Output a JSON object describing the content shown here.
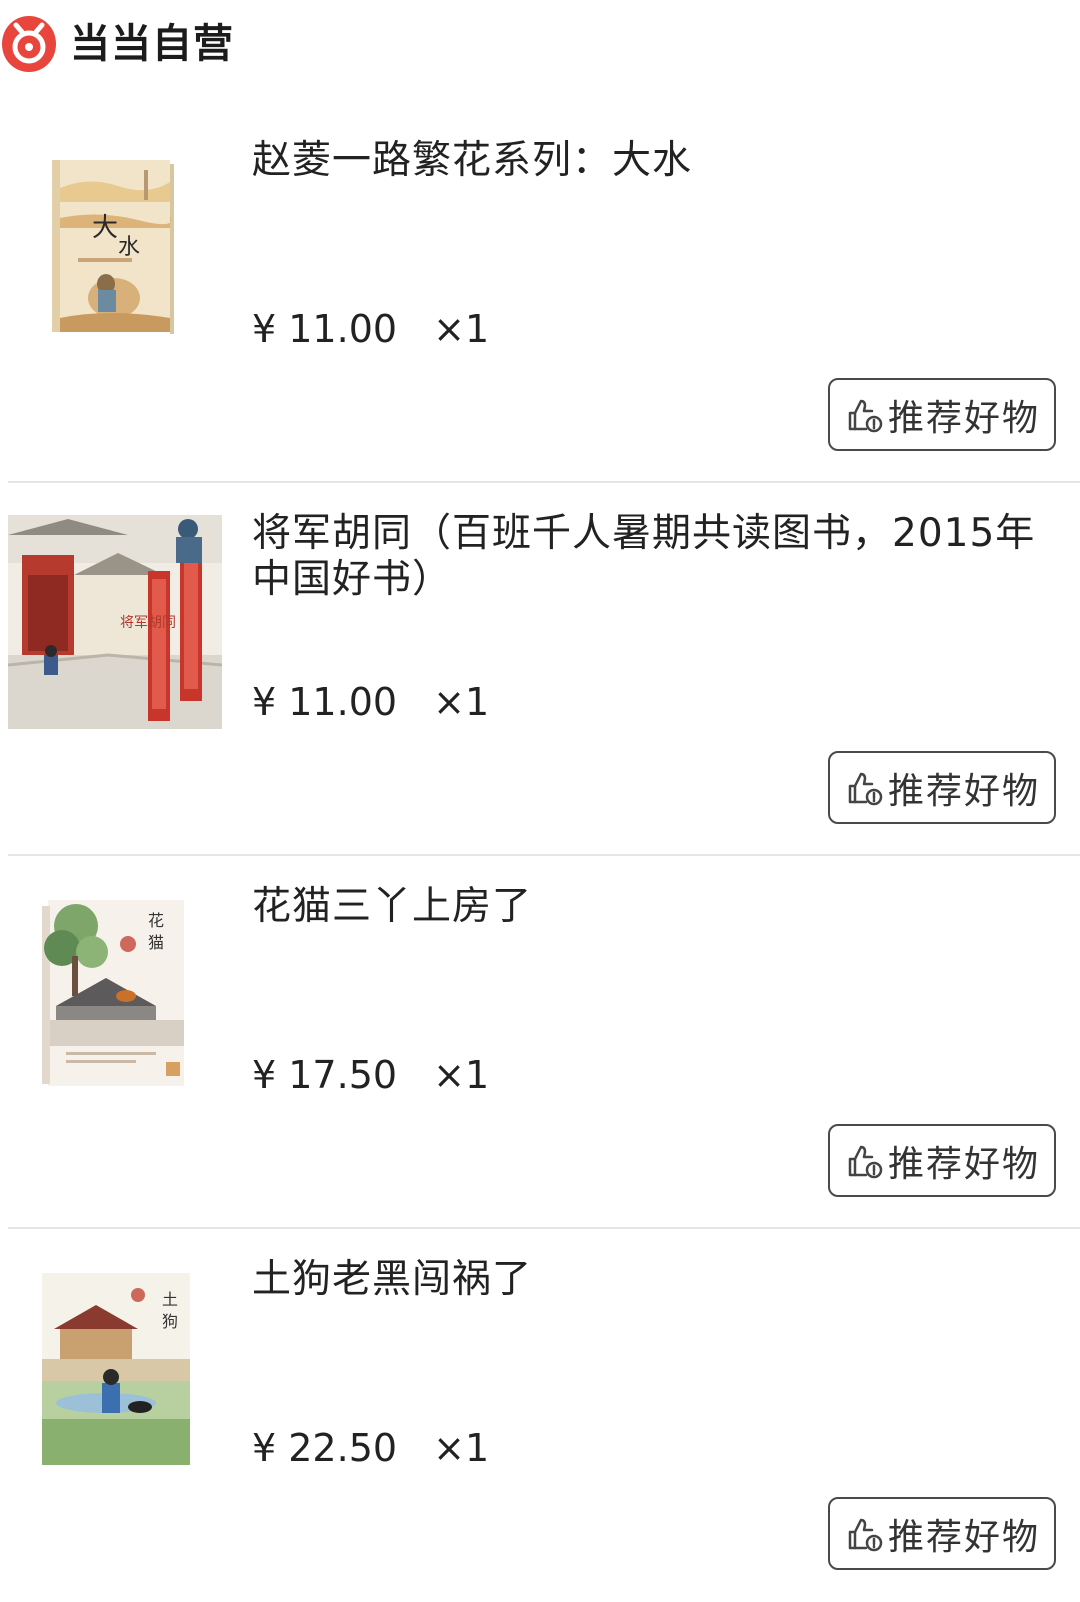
{
  "store": {
    "name": "当当自营",
    "logo_icon": "dangdang-logo-icon",
    "brand_color": "#e8453c"
  },
  "items": [
    {
      "title": "赵菱一路繁花系列：大水",
      "price": "¥ 11.00",
      "quantity": "×1",
      "cover_icon": "book-cover-dashui",
      "recommend_label": "推荐好物"
    },
    {
      "title": "将军胡同（百班千人暑期共读图书，2015年中国好书）",
      "price": "¥ 11.00",
      "quantity": "×1",
      "cover_icon": "book-cover-jiangjun-hutong",
      "recommend_label": "推荐好物"
    },
    {
      "title": "花猫三丫上房了",
      "price": "¥ 17.50",
      "quantity": "×1",
      "cover_icon": "book-cover-huamao-sanya",
      "recommend_label": "推荐好物"
    },
    {
      "title": "土狗老黑闯祸了",
      "price": "¥ 22.50",
      "quantity": "×1",
      "cover_icon": "book-cover-tugou-laohei",
      "recommend_label": "推荐好物"
    }
  ]
}
